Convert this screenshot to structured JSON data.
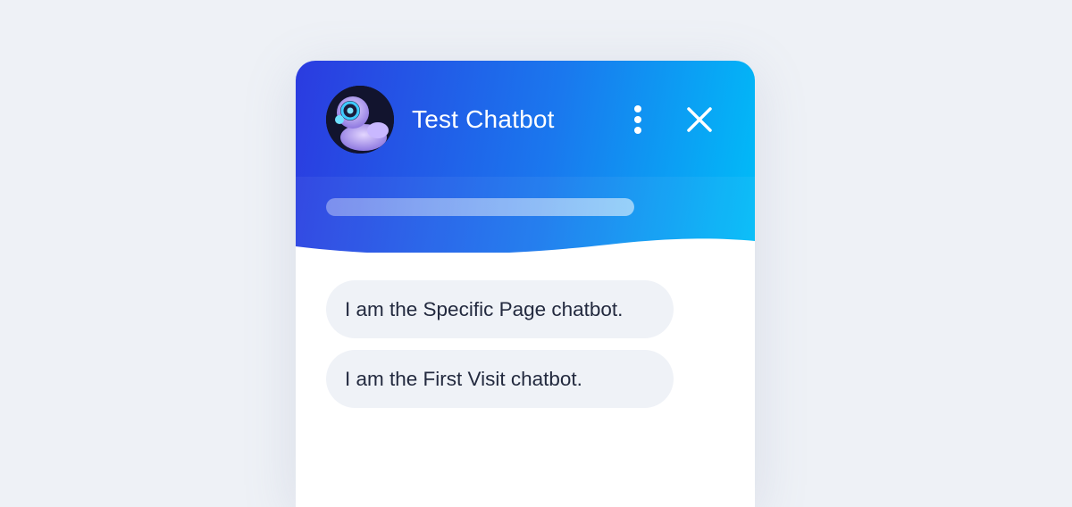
{
  "chat": {
    "title": "Test Chatbot",
    "progress": 1.0
  },
  "messages": [
    {
      "text": "I am the Specific Page chatbot."
    },
    {
      "text": "I am the First Visit chatbot."
    }
  ],
  "icons": {
    "menu": "more-vertical-icon",
    "close": "close-icon",
    "avatar": "robot-avatar"
  },
  "colors": {
    "header_gradient_start": "#2b3be0",
    "header_gradient_end": "#00bdf8",
    "bubble_background": "#eff2f7",
    "page_background": "#eef1f6"
  }
}
